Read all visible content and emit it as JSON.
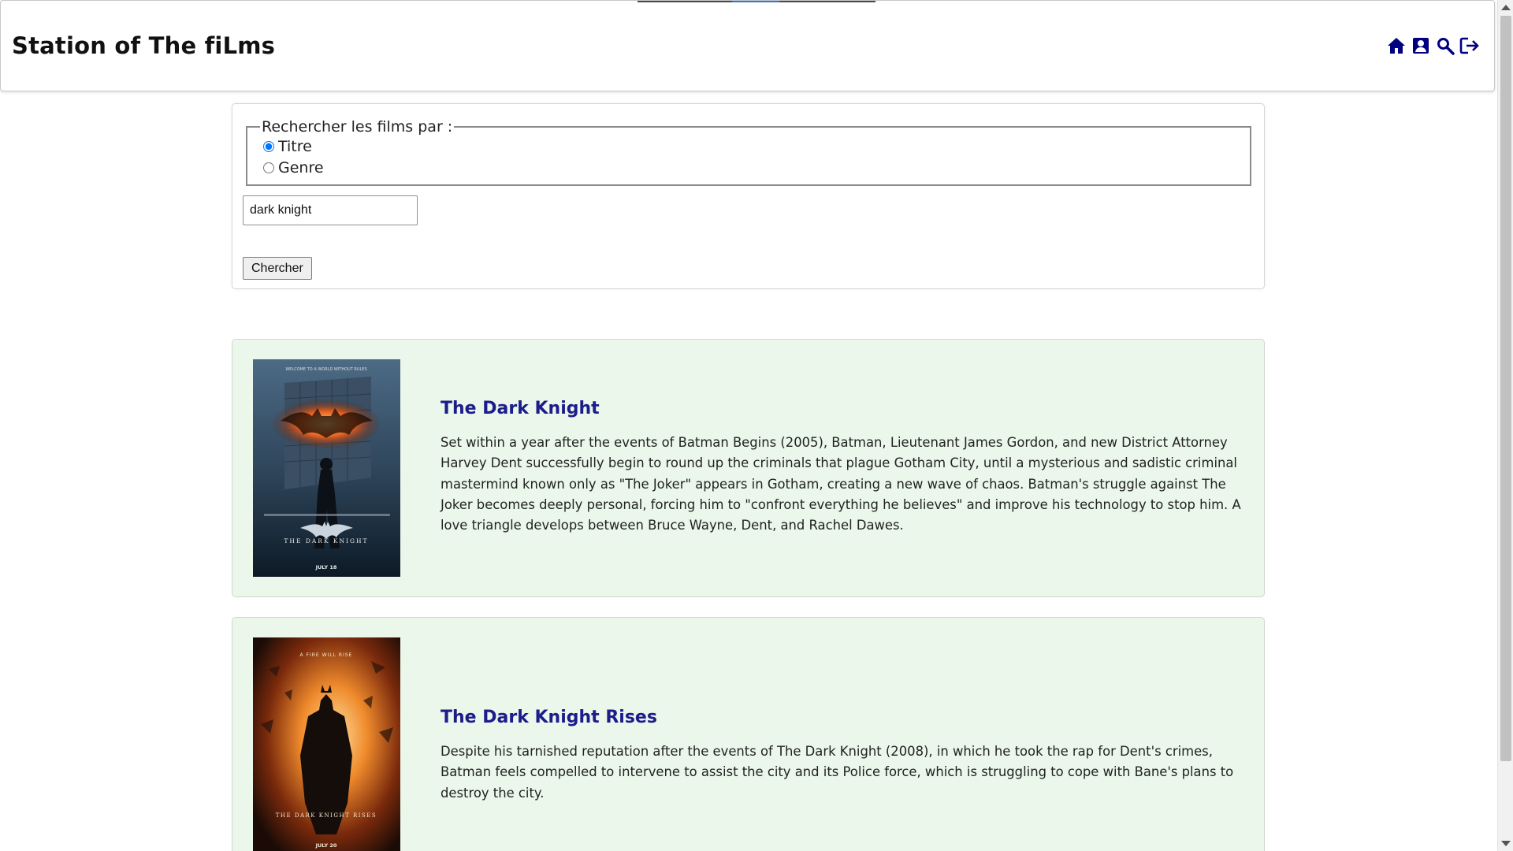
{
  "header": {
    "site_title": "Station of The fiLms",
    "icons": [
      "home-icon",
      "user-profile-icon",
      "search-icon",
      "logout-icon"
    ],
    "icon_color": "#000080"
  },
  "search": {
    "legend": "Rechercher les films par :",
    "options": [
      {
        "label": "Titre",
        "checked": true
      },
      {
        "label": "Genre",
        "checked": false
      }
    ],
    "query_value": "dark knight",
    "button_label": "Chercher"
  },
  "results": [
    {
      "title": "The Dark Knight",
      "description": "Set within a year after the events of Batman Begins (2005), Batman, Lieutenant James Gordon, and new District Attorney Harvey Dent successfully begin to round up the criminals that plague Gotham City, until a mysterious and sadistic criminal mastermind known only as \"The Joker\" appears in Gotham, creating a new wave of chaos. Batman's struggle against The Joker becomes deeply personal, forcing him to \"confront everything he believes\" and improve his technology to stop him. A love triangle develops between Bruce Wayne, Dent, and Rachel Dawes.",
      "poster_texts": [
        "WELCOME TO A WORLD WITHOUT RULES",
        "THE DARK KNIGHT",
        "JULY 18"
      ]
    },
    {
      "title": "The Dark Knight Rises",
      "description": "Despite his tarnished reputation after the events of The Dark Knight (2008), in which he took the rap for Dent's crimes, Batman feels compelled to intervene to assist the city and its Police force, which is struggling to cope with Bane's plans to destroy the city.",
      "poster_texts": [
        "A FIRE WILL RISE",
        "THE DARK KNIGHT RISES",
        "JULY 20"
      ]
    }
  ],
  "colors": {
    "card_background": "#eaf7ea",
    "title_color": "#1c1c8a"
  }
}
